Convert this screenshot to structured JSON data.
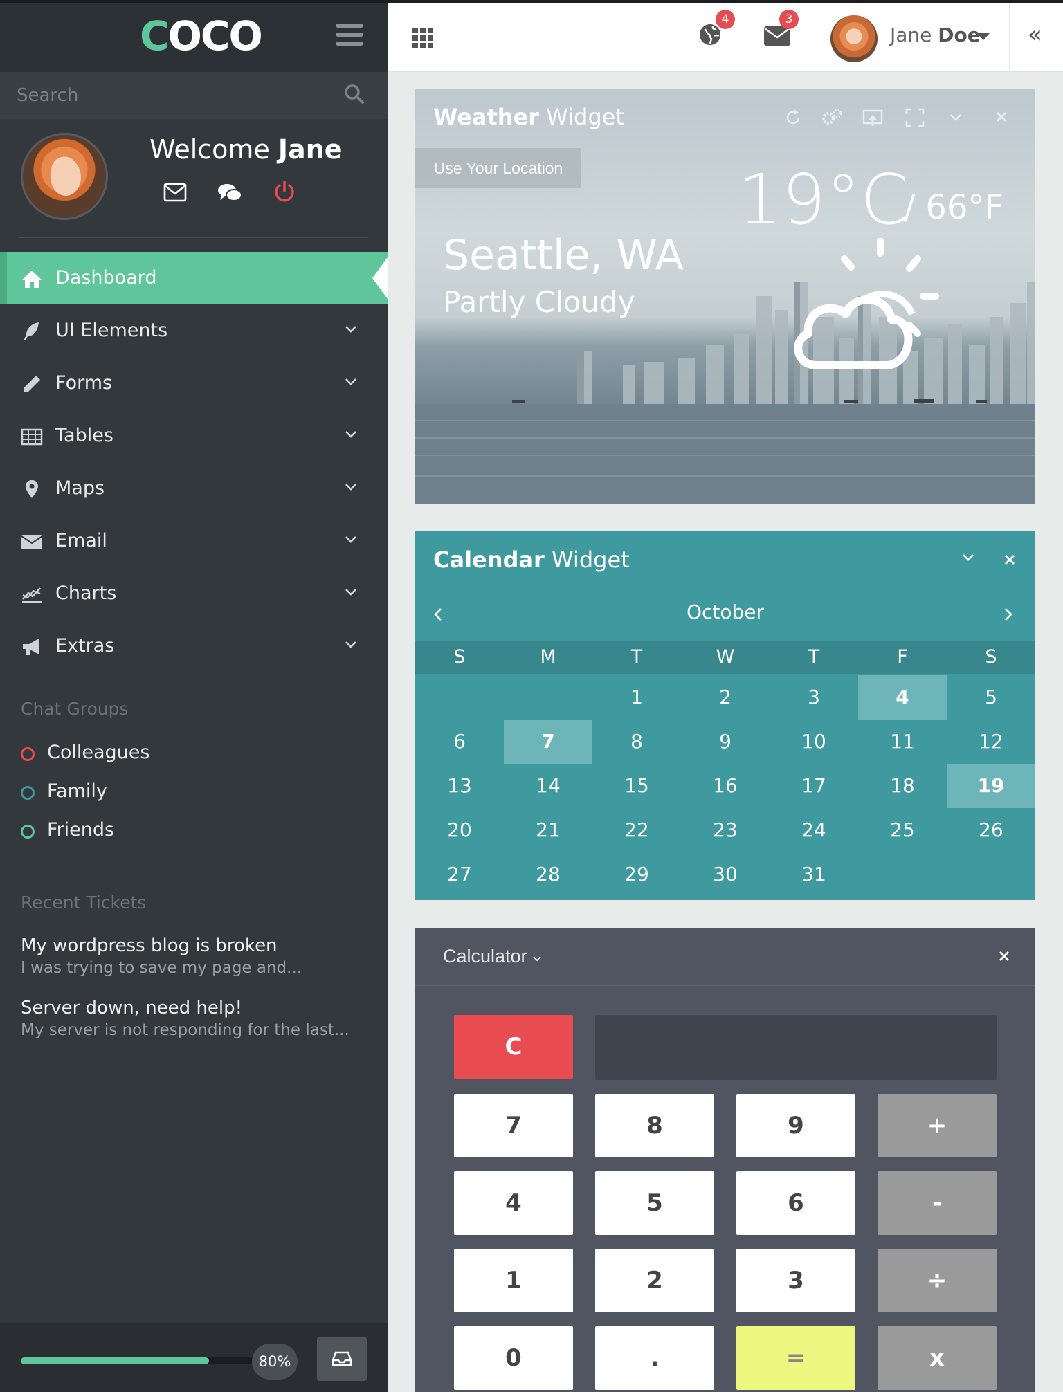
{
  "brand": {
    "logo_first": "C",
    "logo_rest": "OCO"
  },
  "sidebar": {
    "search_placeholder": "Search",
    "welcome_prefix": "Welcome",
    "welcome_name": "Jane",
    "nav": [
      {
        "label": "Dashboard",
        "icon": "home-icon",
        "active": true
      },
      {
        "label": "UI Elements",
        "icon": "feather-icon"
      },
      {
        "label": "Forms",
        "icon": "pencil-icon"
      },
      {
        "label": "Tables",
        "icon": "table-icon"
      },
      {
        "label": "Maps",
        "icon": "map-marker-icon"
      },
      {
        "label": "Email",
        "icon": "envelope-icon"
      },
      {
        "label": "Charts",
        "icon": "line-chart-icon"
      },
      {
        "label": "Extras",
        "icon": "bullhorn-icon"
      }
    ],
    "chat_groups_title": "Chat Groups",
    "chat_groups": [
      {
        "label": "Colleagues",
        "color": "#e84c50"
      },
      {
        "label": "Family",
        "color": "#3f9aa0"
      },
      {
        "label": "Friends",
        "color": "#5ec69a"
      }
    ],
    "recent_tickets_title": "Recent Tickets",
    "tickets": [
      {
        "title": "My wordpress blog is broken",
        "snippet": "I was trying to save my page and..."
      },
      {
        "title": "Server down, need help!",
        "snippet": "My server is not responding for the last..."
      }
    ],
    "progress": {
      "value": 0.8,
      "label": "80%"
    }
  },
  "header": {
    "notifications_count": "4",
    "messages_count": "3",
    "user_first": "Jane",
    "user_last": "Doe"
  },
  "weather": {
    "title_bold": "Weather",
    "title_rest": "Widget",
    "location_button": "Use Your Location",
    "temp_c": "19°C",
    "temp_f": "/ 66°F",
    "city": "Seattle, WA",
    "condition": "Partly Cloudy"
  },
  "calendar": {
    "title_bold": "Calendar",
    "title_rest": "Widget",
    "month": "October",
    "weekdays": [
      "S",
      "M",
      "T",
      "W",
      "T",
      "F",
      "S"
    ],
    "weeks": [
      [
        "",
        "",
        "1",
        "2",
        "3",
        "4",
        "5"
      ],
      [
        "6",
        "7",
        "8",
        "9",
        "10",
        "11",
        "12"
      ],
      [
        "13",
        "14",
        "15",
        "16",
        "17",
        "18",
        "19"
      ],
      [
        "20",
        "21",
        "22",
        "23",
        "24",
        "25",
        "26"
      ],
      [
        "27",
        "28",
        "29",
        "30",
        "31",
        "",
        ""
      ]
    ],
    "highlighted": [
      "4",
      "7",
      "19"
    ]
  },
  "calculator": {
    "title": "Calculator",
    "display_value": "",
    "keys": {
      "clear": "C",
      "k7": "7",
      "k8": "8",
      "k9": "9",
      "plus": "+",
      "k4": "4",
      "k5": "5",
      "k6": "6",
      "minus": "-",
      "k1": "1",
      "k2": "2",
      "k3": "3",
      "divide": "÷",
      "k0": "0",
      "dot": ".",
      "equals": "=",
      "times": "x"
    }
  },
  "colors": {
    "accent": "#5ec69a",
    "teal": "#3f9aa0",
    "danger": "#e84c50",
    "sidebar": "#33383d"
  }
}
